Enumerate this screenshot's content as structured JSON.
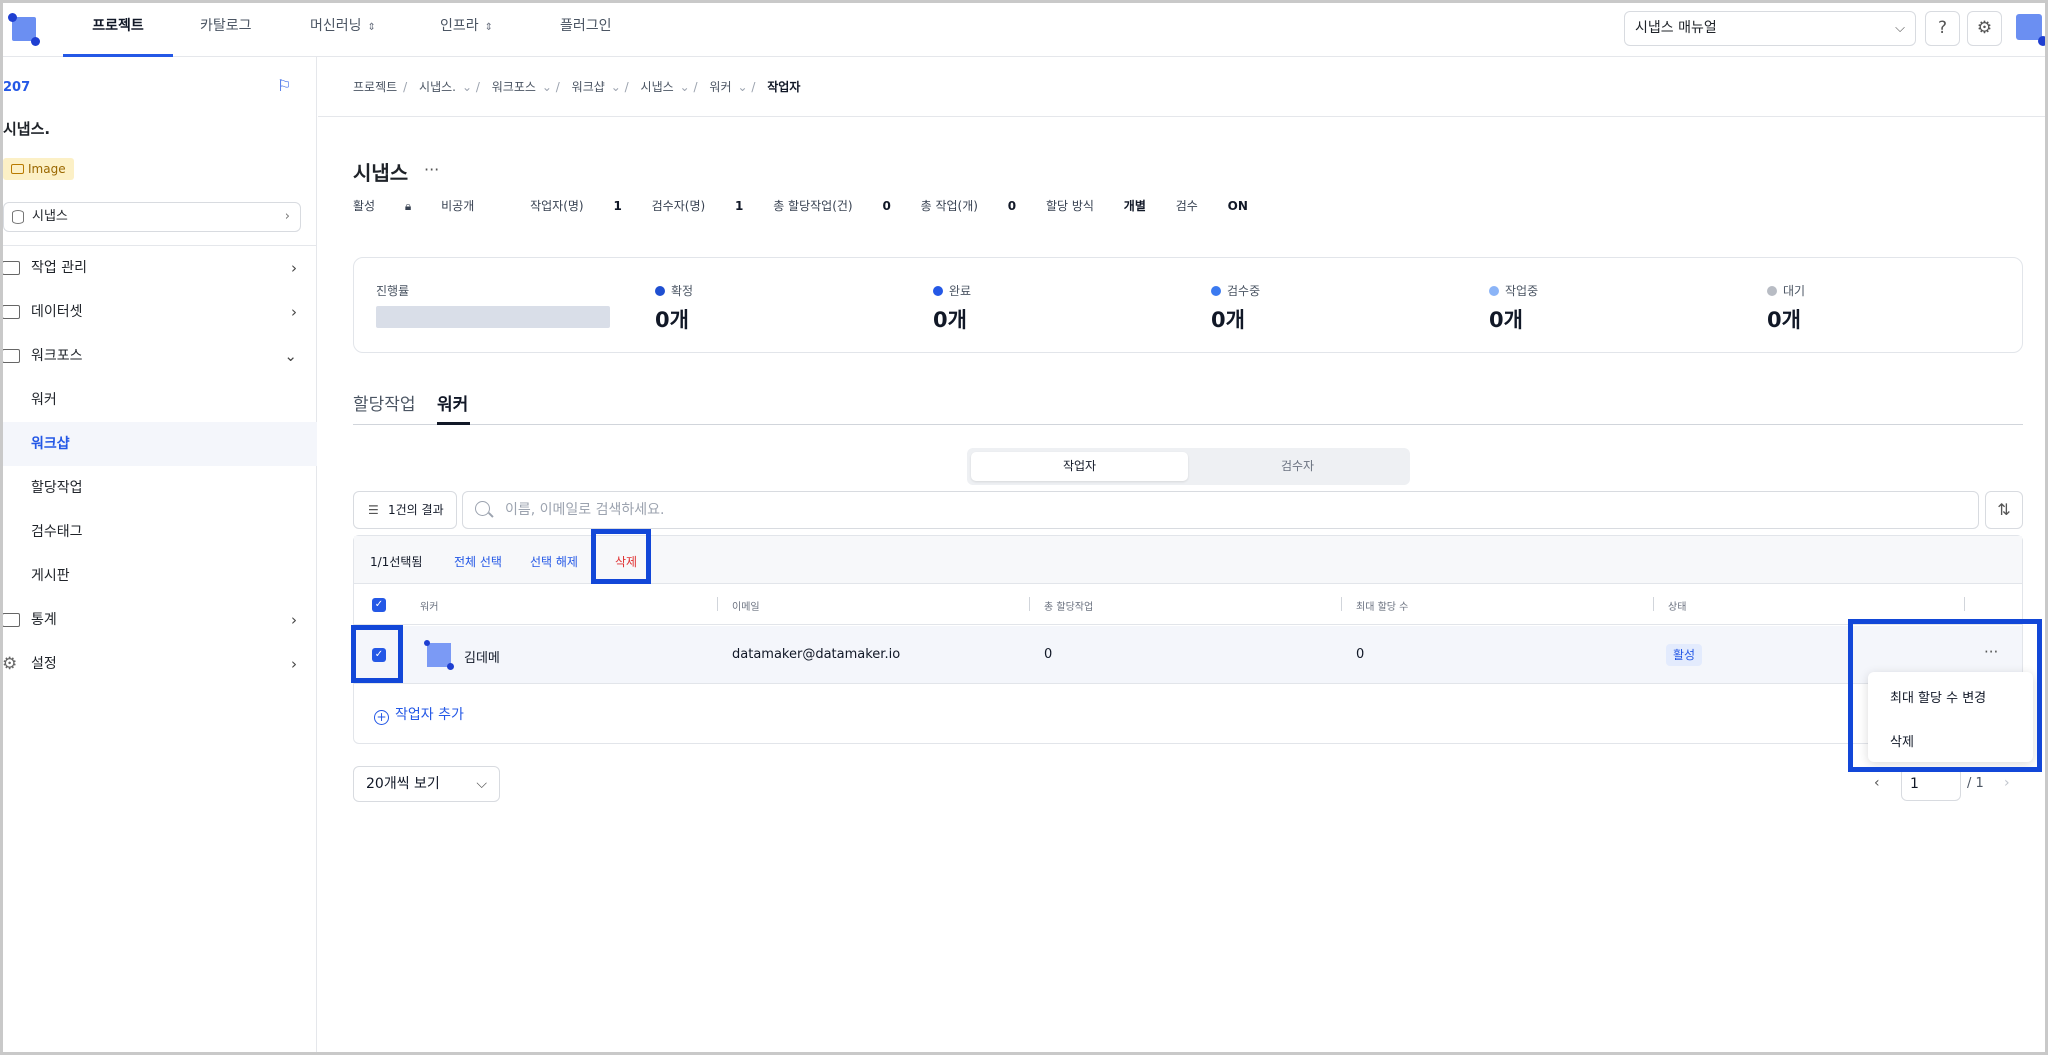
{
  "nav": {
    "tabs": [
      {
        "label": "프로젝트"
      },
      {
        "label": "카탈로그"
      },
      {
        "label": "머신러닝"
      },
      {
        "label": "인프라"
      },
      {
        "label": "플러그인"
      }
    ],
    "manual": "시냅스 매뉴얼"
  },
  "sidebar": {
    "project_id": "207",
    "project_name": "시냅스.",
    "type_badge": "Image",
    "dataset": "시냅스",
    "menu": [
      {
        "label": "작업 관리"
      },
      {
        "label": "데이터셋"
      },
      {
        "label": "워크포스"
      }
    ],
    "submenu": [
      {
        "label": "워커"
      },
      {
        "label": "워크샵"
      },
      {
        "label": "할당작업"
      },
      {
        "label": "검수태그"
      },
      {
        "label": "게시판"
      }
    ],
    "menu2": [
      {
        "label": "통계"
      },
      {
        "label": "설정"
      }
    ]
  },
  "breadcrumb": [
    "프로젝트",
    "시냅스.",
    "워크포스",
    "워크샵",
    "시냅스",
    "워커",
    "작업자"
  ],
  "header": {
    "title": "시냅스",
    "status": "활성",
    "visibility": "비공개",
    "workers_label": "작업자(명)",
    "workers": "1",
    "reviewers_label": "검수자(명)",
    "reviewers": "1",
    "total_assign_label": "총 할당작업(건)",
    "total_assign": "0",
    "total_tasks_label": "총 작업(개)",
    "total_tasks": "0",
    "assign_method_label": "할당 방식",
    "assign_method": "개별",
    "review_label": "검수",
    "review": "ON"
  },
  "stats": {
    "progress_label": "진행률",
    "progress": 0,
    "items": [
      {
        "label": "확정",
        "value": "0개",
        "color": "#1f4fd1"
      },
      {
        "label": "완료",
        "value": "0개",
        "color": "#2458e6"
      },
      {
        "label": "검수중",
        "value": "0개",
        "color": "#3b7af0"
      },
      {
        "label": "작업중",
        "value": "0개",
        "color": "#8bb4f7"
      },
      {
        "label": "대기",
        "value": "0개",
        "color": "#b8bcc4"
      }
    ]
  },
  "tabs": {
    "assign": "할당작업",
    "worker": "워커"
  },
  "segment": {
    "worker": "작업자",
    "reviewer": "검수자"
  },
  "toolbar": {
    "result": "1건의 결과",
    "search_placeholder": "이름, 이메일로 검색하세요."
  },
  "selection": {
    "count": "1/1선택됨",
    "select_all": "전체 선택",
    "deselect": "선택 해제",
    "delete": "삭제"
  },
  "table": {
    "columns": [
      "워커",
      "이메일",
      "총 할당작업",
      "최대 할당 수",
      "상태"
    ],
    "rows": [
      {
        "name": "김데메",
        "email": "datamaker@datamaker.io",
        "total": "0",
        "max": "0",
        "status": "활성"
      }
    ],
    "add": "작업자 추가"
  },
  "row_menu": {
    "change_max": "최대 할당 수 변경",
    "delete": "삭제"
  },
  "pagination": {
    "per_page": "20개씩 보기",
    "page": "1",
    "total": "/ 1"
  }
}
